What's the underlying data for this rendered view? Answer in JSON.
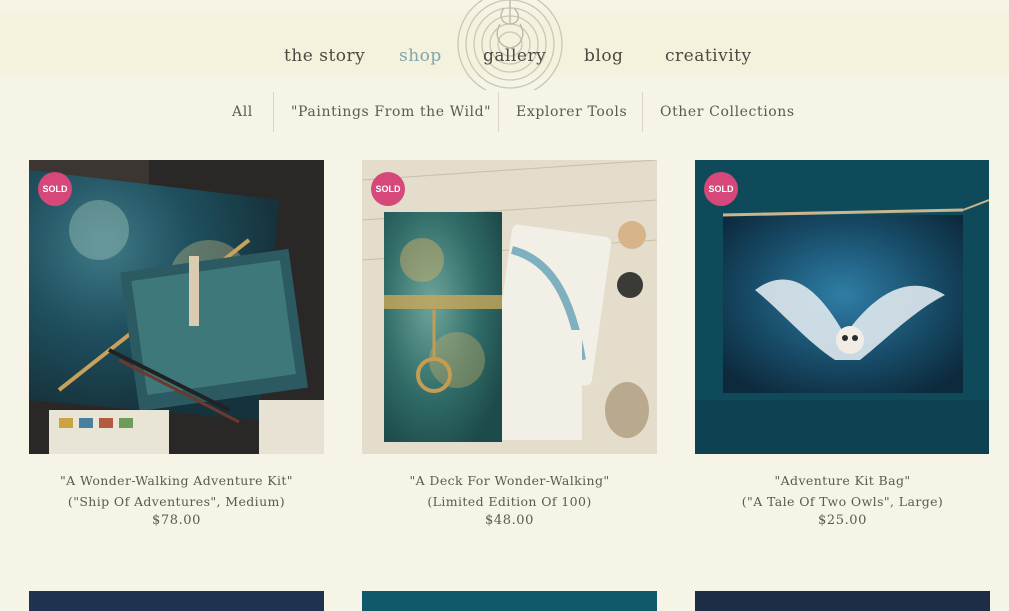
{
  "nav": {
    "items": [
      {
        "label": "the story",
        "active": false
      },
      {
        "label": "shop",
        "active": true
      },
      {
        "label": "gallery",
        "active": false
      },
      {
        "label": "blog",
        "active": false
      },
      {
        "label": "creativity",
        "active": false
      }
    ]
  },
  "subnav": {
    "items": [
      {
        "label": "All"
      },
      {
        "label": "\"Paintings From the Wild\""
      },
      {
        "label": "Explorer Tools"
      },
      {
        "label": "Other Collections"
      }
    ]
  },
  "products": [
    {
      "badge": "SOLD",
      "title": "\"A Wonder-Walking Adventure Kit\"",
      "subtitle": "(\"Ship Of Adventures\", Medium)",
      "price": "$78.00"
    },
    {
      "badge": "SOLD",
      "title": "\"A Deck For Wonder-Walking\"",
      "subtitle": "(Limited Edition Of 100)",
      "price": "$48.00"
    },
    {
      "badge": "SOLD",
      "title": "\"Adventure Kit Bag\"",
      "subtitle": "(\"A Tale Of Two Owls\", Large)",
      "price": "$25.00"
    }
  ],
  "colors": {
    "background": "#f6f4e6",
    "accent": "#7ea7ad",
    "sold_badge": "#d6477a",
    "text": "#4a4a44"
  }
}
